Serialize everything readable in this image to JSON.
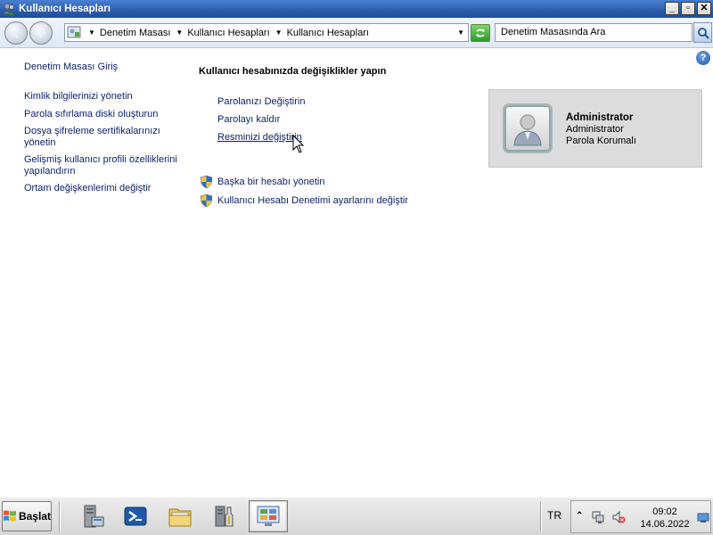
{
  "window": {
    "title": "Kullanıcı Hesapları"
  },
  "titlebar_buttons": {
    "minimize": "_",
    "restore": "▫",
    "close": "✕"
  },
  "address_bar": {
    "breadcrumbs": [
      "Denetim Masası",
      "Kullanıcı Hesapları",
      "Kullanıcı Hesapları"
    ]
  },
  "search": {
    "placeholder": "Denetim Masasında Ara"
  },
  "help": {
    "label": "?"
  },
  "sidebar": {
    "home": "Denetim Masası Giriş",
    "links": [
      "Kimlik bilgilerinizi yönetin",
      "Parola sıfırlama diski oluşturun",
      "Dosya şifreleme sertifikalarınızı yönetin",
      "Gelişmiş kullanıcı profili özelliklerini yapılandırın",
      "Ortam değişkenlerimi değiştir"
    ]
  },
  "main": {
    "heading": "Kullanıcı hesabınızda değişiklikler yapın",
    "tasks": [
      "Parolanızı Değiştirin",
      "Parolayı kaldır",
      "Resminizi değiştirin"
    ],
    "admin_links": [
      "Başka bir hesabı yönetin",
      "Kullanıcı Hesabı Denetimi ayarlarını değiştir"
    ]
  },
  "user": {
    "name": "Administrator",
    "role": "Administrator",
    "status": "Parola Korumalı"
  },
  "taskbar": {
    "start_label": "Başlat",
    "language": "TR",
    "time": "09:02",
    "date": "14.06.2022",
    "apps": [
      "server-manager-icon",
      "powershell-icon",
      "file-explorer-icon",
      "control-panel-tools-icon",
      "user-accounts-icon"
    ]
  },
  "colors": {
    "link": "#0b1f6e",
    "titlebar": "#2a5caa",
    "panel": "#dcdcdc"
  }
}
